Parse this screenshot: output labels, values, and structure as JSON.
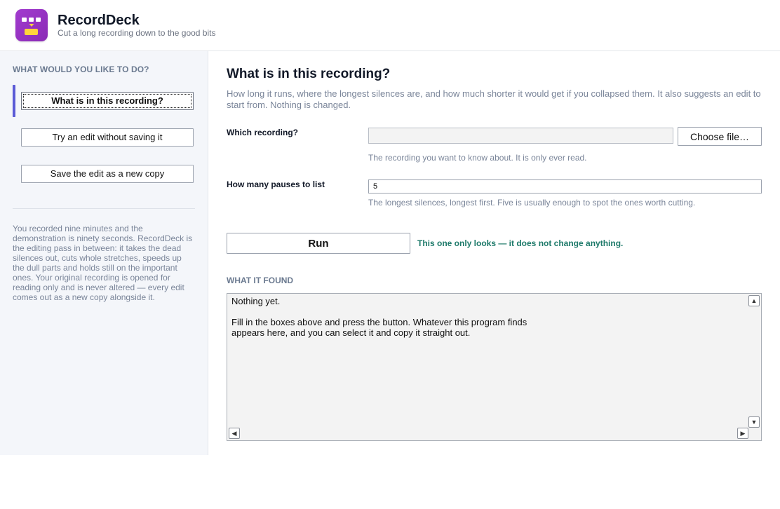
{
  "app": {
    "title": "RecordDeck",
    "subtitle": "Cut a long recording down to the good bits",
    "logo_icon": "recorddeck-logo-icon",
    "brand_color": "#9b35c8"
  },
  "sidebar": {
    "heading": "WHAT WOULD YOU LIKE TO DO?",
    "items": [
      {
        "label": "What is in this recording?",
        "active": true
      },
      {
        "label": "Try an edit without saving it",
        "active": false
      },
      {
        "label": "Save the edit as a new copy",
        "active": false
      }
    ],
    "description": "You recorded nine minutes and the demonstration is ninety seconds. RecordDeck is the editing pass in between: it takes the dead silences out, cuts whole stretches, speeds up the dull parts and holds still on the important ones. Your original recording is opened for reading only and is never altered — every edit comes out as a new copy alongside it.",
    "accent_color": "#5b5bd6"
  },
  "main": {
    "title": "What is in this recording?",
    "description": "How long it runs, where the longest silences are, and how much shorter it would get if you collapsed them. It also suggests an edit to start from. Nothing is changed.",
    "fields": {
      "recording": {
        "label": "Which recording?",
        "value": "",
        "button_label": "Choose file…",
        "help": "The recording you want to know about. It is only ever read."
      },
      "pauses": {
        "label": "How many pauses to list",
        "value": "5",
        "help": "The longest silences, longest first. Five is usually enough to spot the ones worth cutting."
      }
    },
    "run_label": "Run",
    "run_note": "This one only looks — it does not change anything.",
    "run_note_color": "#1e7a6a",
    "results_heading": "WHAT IT FOUND",
    "results_text": "Nothing yet.\n\nFill in the boxes above and press the button. Whatever this program finds\nappears here, and you can select it and copy it straight out."
  }
}
